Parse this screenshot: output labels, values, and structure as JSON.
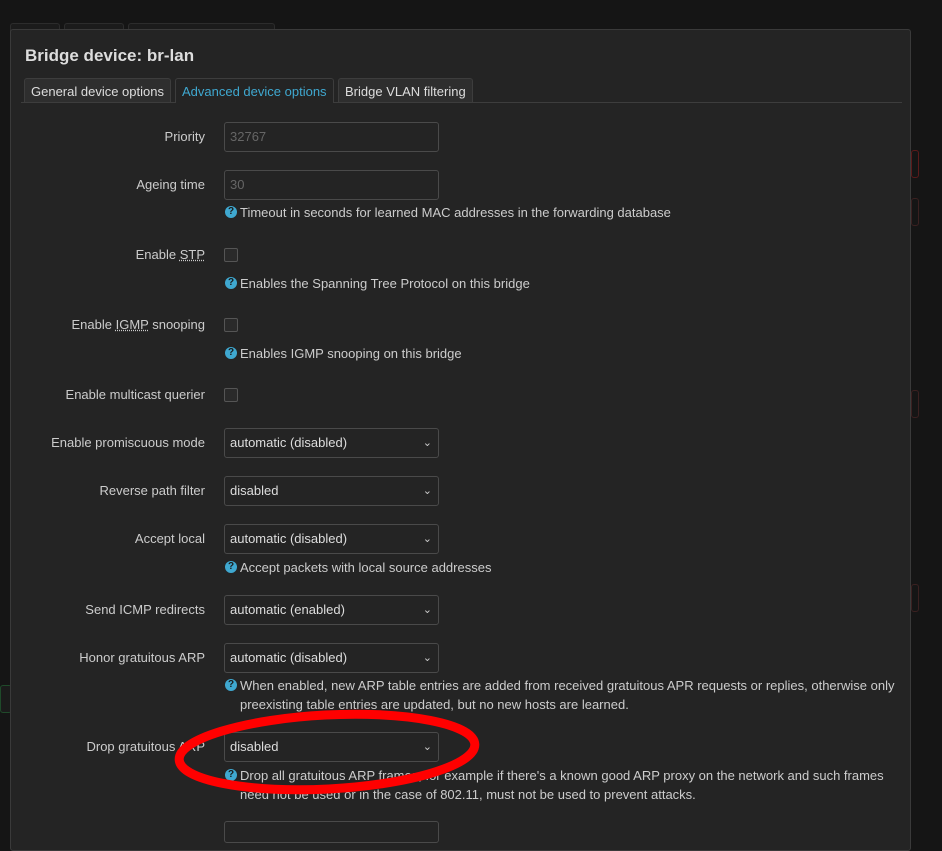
{
  "dialog": {
    "title": "Bridge device: br-lan"
  },
  "tabs": [
    {
      "label": "General device options",
      "active": false
    },
    {
      "label": "Advanced device options",
      "active": true
    },
    {
      "label": "Bridge VLAN filtering",
      "active": false
    }
  ],
  "fields": {
    "priority": {
      "label": "Priority",
      "placeholder": "32767"
    },
    "ageing": {
      "label": "Ageing time",
      "placeholder": "30",
      "help": "Timeout in seconds for learned MAC addresses in the forwarding database"
    },
    "stp": {
      "label_pre": "Enable ",
      "label_abbr": "STP",
      "checked": false,
      "help": "Enables the Spanning Tree Protocol on this bridge"
    },
    "igmp": {
      "label_pre": "Enable ",
      "label_abbr": "IGMP",
      "label_post": " snooping",
      "checked": false,
      "help": "Enables IGMP snooping on this bridge"
    },
    "multicast": {
      "label": "Enable multicast querier",
      "checked": false
    },
    "promisc": {
      "label": "Enable promiscuous mode",
      "value": "automatic (disabled)"
    },
    "rpfilter": {
      "label": "Reverse path filter",
      "value": "disabled"
    },
    "acceptlocal": {
      "label": "Accept local",
      "value": "automatic (disabled)",
      "help": "Accept packets with local source addresses"
    },
    "icmpredirect": {
      "label": "Send ICMP redirects",
      "value": "automatic (enabled)"
    },
    "honorarp": {
      "label": "Honor gratuitous ARP",
      "value": "automatic (disabled)",
      "help": "When enabled, new ARP table entries are added from received gratuitous APR requests or replies, otherwise only preexisting table entries are updated, but no new hosts are learned."
    },
    "droparp": {
      "label": "Drop gratuitous ARP",
      "value": "disabled",
      "help": "Drop all gratuitous ARP frames, for example if there's a known good ARP proxy on the network and such frames need not be used or in the case of 802.11, must not be used to prevent attacks."
    }
  },
  "icons": {
    "help": "question-circle-icon",
    "select": "chevron-down-icon"
  },
  "colors": {
    "accent": "#3fa8d0",
    "annotation": "#ff0000"
  }
}
